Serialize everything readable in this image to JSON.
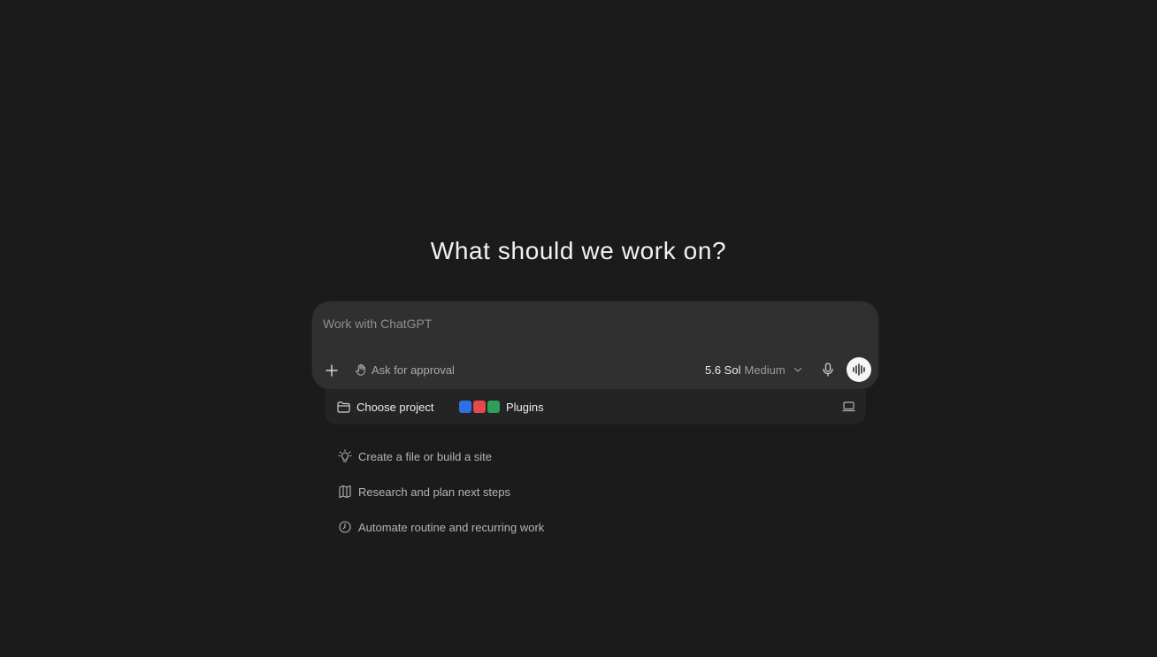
{
  "headline": "What should we work on?",
  "composer": {
    "placeholder": "Work with ChatGPT",
    "approval_label": "Ask for approval",
    "model_name": "5.6 Sol",
    "effort_label": "Medium"
  },
  "bottom_bar": {
    "project_label": "Choose project",
    "plugins_label": "Plugins"
  },
  "suggestions": [
    {
      "icon": "lightbulb-icon",
      "label": "Create a file or build a site"
    },
    {
      "icon": "map-icon",
      "label": "Research and plan next steps"
    },
    {
      "icon": "clock-icon",
      "label": "Automate routine and recurring work"
    }
  ],
  "colors": {
    "background": "#1b1b1b",
    "composer": "#303030",
    "bottom_bar": "#242424",
    "plugin_docs": "#2f6fe6",
    "plugin_pdf": "#e5484d",
    "plugin_sheets": "#2e9e5a"
  }
}
